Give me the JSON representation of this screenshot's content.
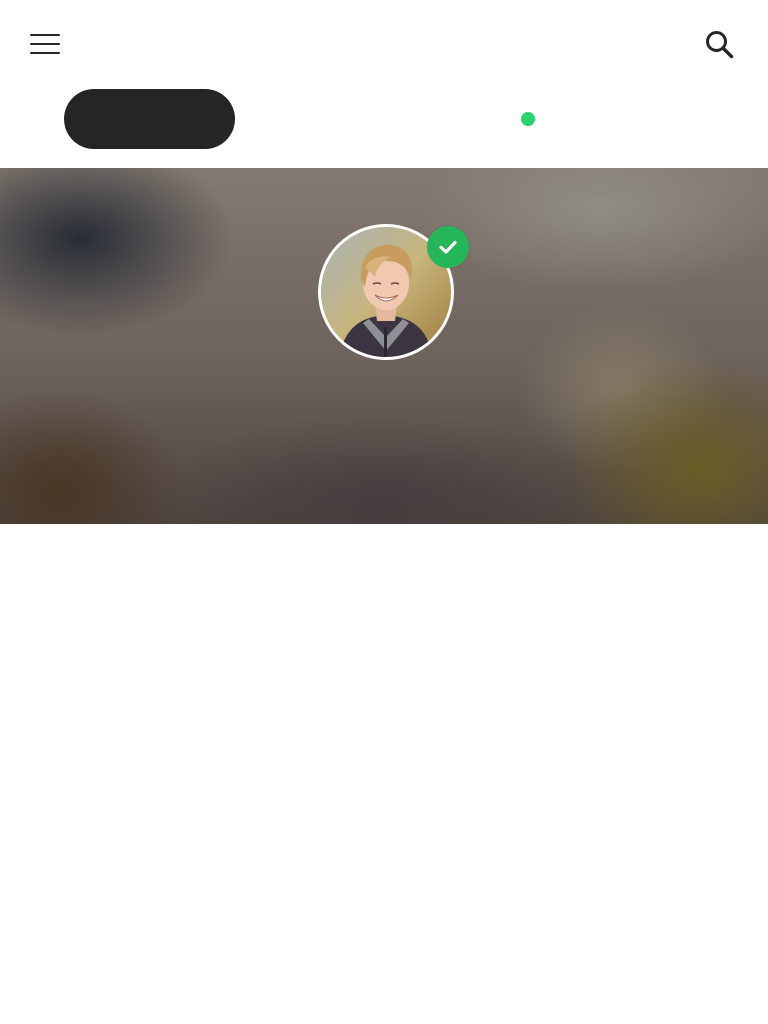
{
  "header": {
    "menu_icon": "hamburger-menu-icon",
    "search_icon": "search-icon"
  },
  "tabs": {
    "active_label": "",
    "status_dot_color": "#2ad46f"
  },
  "profile": {
    "avatar_icon": "user-avatar",
    "verified": true,
    "verified_icon": "check-icon",
    "verified_color": "#25b659"
  },
  "colors": {
    "pill": "#252525",
    "text": "#262626",
    "background": "#ffffff"
  }
}
